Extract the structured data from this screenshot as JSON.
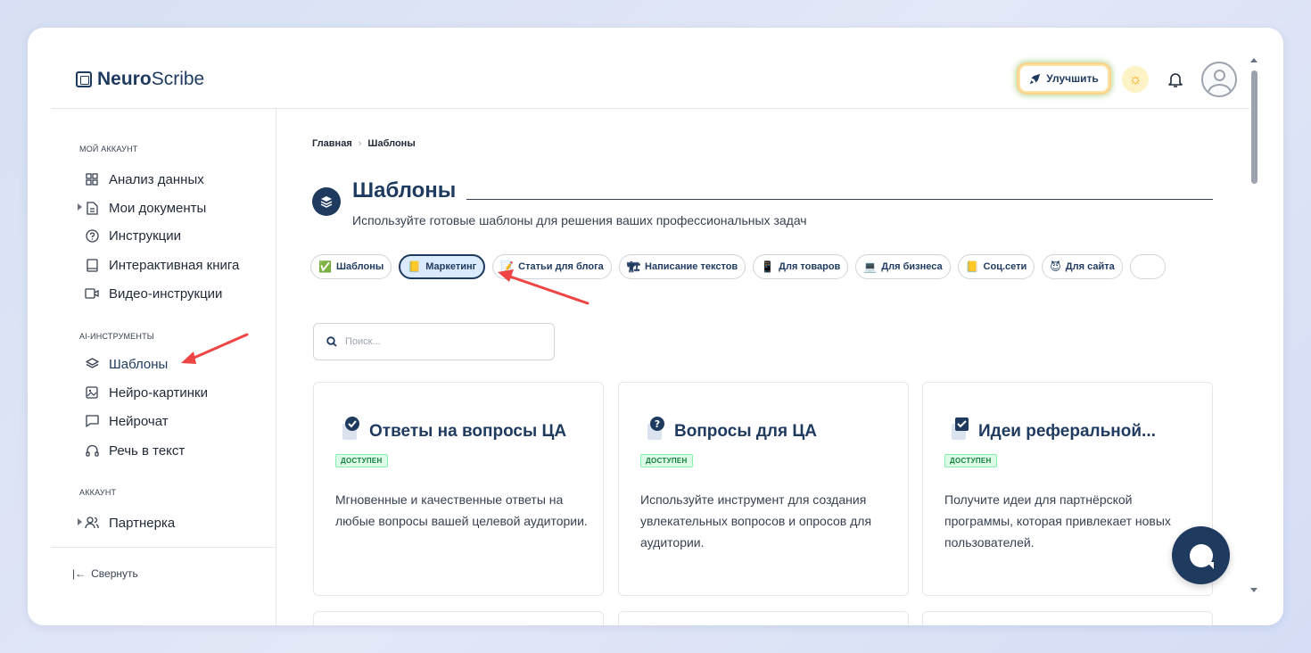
{
  "app": {
    "logo_bold": "Neuro",
    "logo_light": "Scribe"
  },
  "header": {
    "upgrade_label": "Улучшить"
  },
  "sidebar": {
    "sections": [
      {
        "title": "МОЙ АККАУНТ"
      },
      {
        "title": "AI-ИНСТРУМЕНТЫ"
      },
      {
        "title": "АККАУНТ"
      }
    ],
    "items": [
      {
        "label": "Анализ данных",
        "icon": "grid-icon"
      },
      {
        "label": "Мои документы",
        "icon": "document-icon"
      },
      {
        "label": "Инструкции",
        "icon": "help-circle-icon"
      },
      {
        "label": "Интерактивная книга",
        "icon": "book-icon"
      },
      {
        "label": "Видео-инструкции",
        "icon": "video-icon"
      },
      {
        "label": "Шаблоны",
        "icon": "layers-icon"
      },
      {
        "label": "Нейро-картинки",
        "icon": "image-icon"
      },
      {
        "label": "Нейрочат",
        "icon": "chat-icon"
      },
      {
        "label": "Речь в текст",
        "icon": "headphones-icon"
      },
      {
        "label": "Партнерка",
        "icon": "users-icon"
      }
    ],
    "collapse_label": "Свернуть"
  },
  "main": {
    "breadcrumb": {
      "home": "Главная",
      "sep": "›",
      "current": "Шаблоны"
    },
    "title": "Шаблоны",
    "subtitle": "Используйте готовые шаблоны для решения ваших профессиональных задач",
    "chips": [
      {
        "label": "Шаблоны",
        "emoji": "✅"
      },
      {
        "label": "Маркетинг",
        "emoji": "📒"
      },
      {
        "label": "Статьи для блога",
        "emoji": "📝"
      },
      {
        "label": "Написание текстов",
        "emoji": "🏗"
      },
      {
        "label": "Для товаров",
        "emoji": "📱"
      },
      {
        "label": "Для бизнеса",
        "emoji": "💻"
      },
      {
        "label": "Соц.сети",
        "emoji": "📒"
      },
      {
        "label": "Для сайта",
        "emoji": "😈"
      }
    ],
    "search_placeholder": "Поиск...",
    "cards": [
      {
        "title": "Ответы на вопросы ЦА",
        "badge": "ДОСТУПЕН",
        "description": "Мгновенные и качественные ответы на любые вопросы вашей целевой аудитории."
      },
      {
        "title": "Вопросы для ЦА",
        "badge": "ДОСТУПЕН",
        "description": "Используйте инструмент для создания увлекательных вопросов и опросов для аудитории."
      },
      {
        "title": "Идеи реферальной...",
        "badge": "ДОСТУПЕН",
        "description": "Получите идеи для партнёрской программы, которая привлекает новых пользователей."
      }
    ]
  },
  "colors": {
    "primary": "#1e3a5f",
    "badge_green": "#15803d",
    "arrow_red": "#ef4444"
  }
}
